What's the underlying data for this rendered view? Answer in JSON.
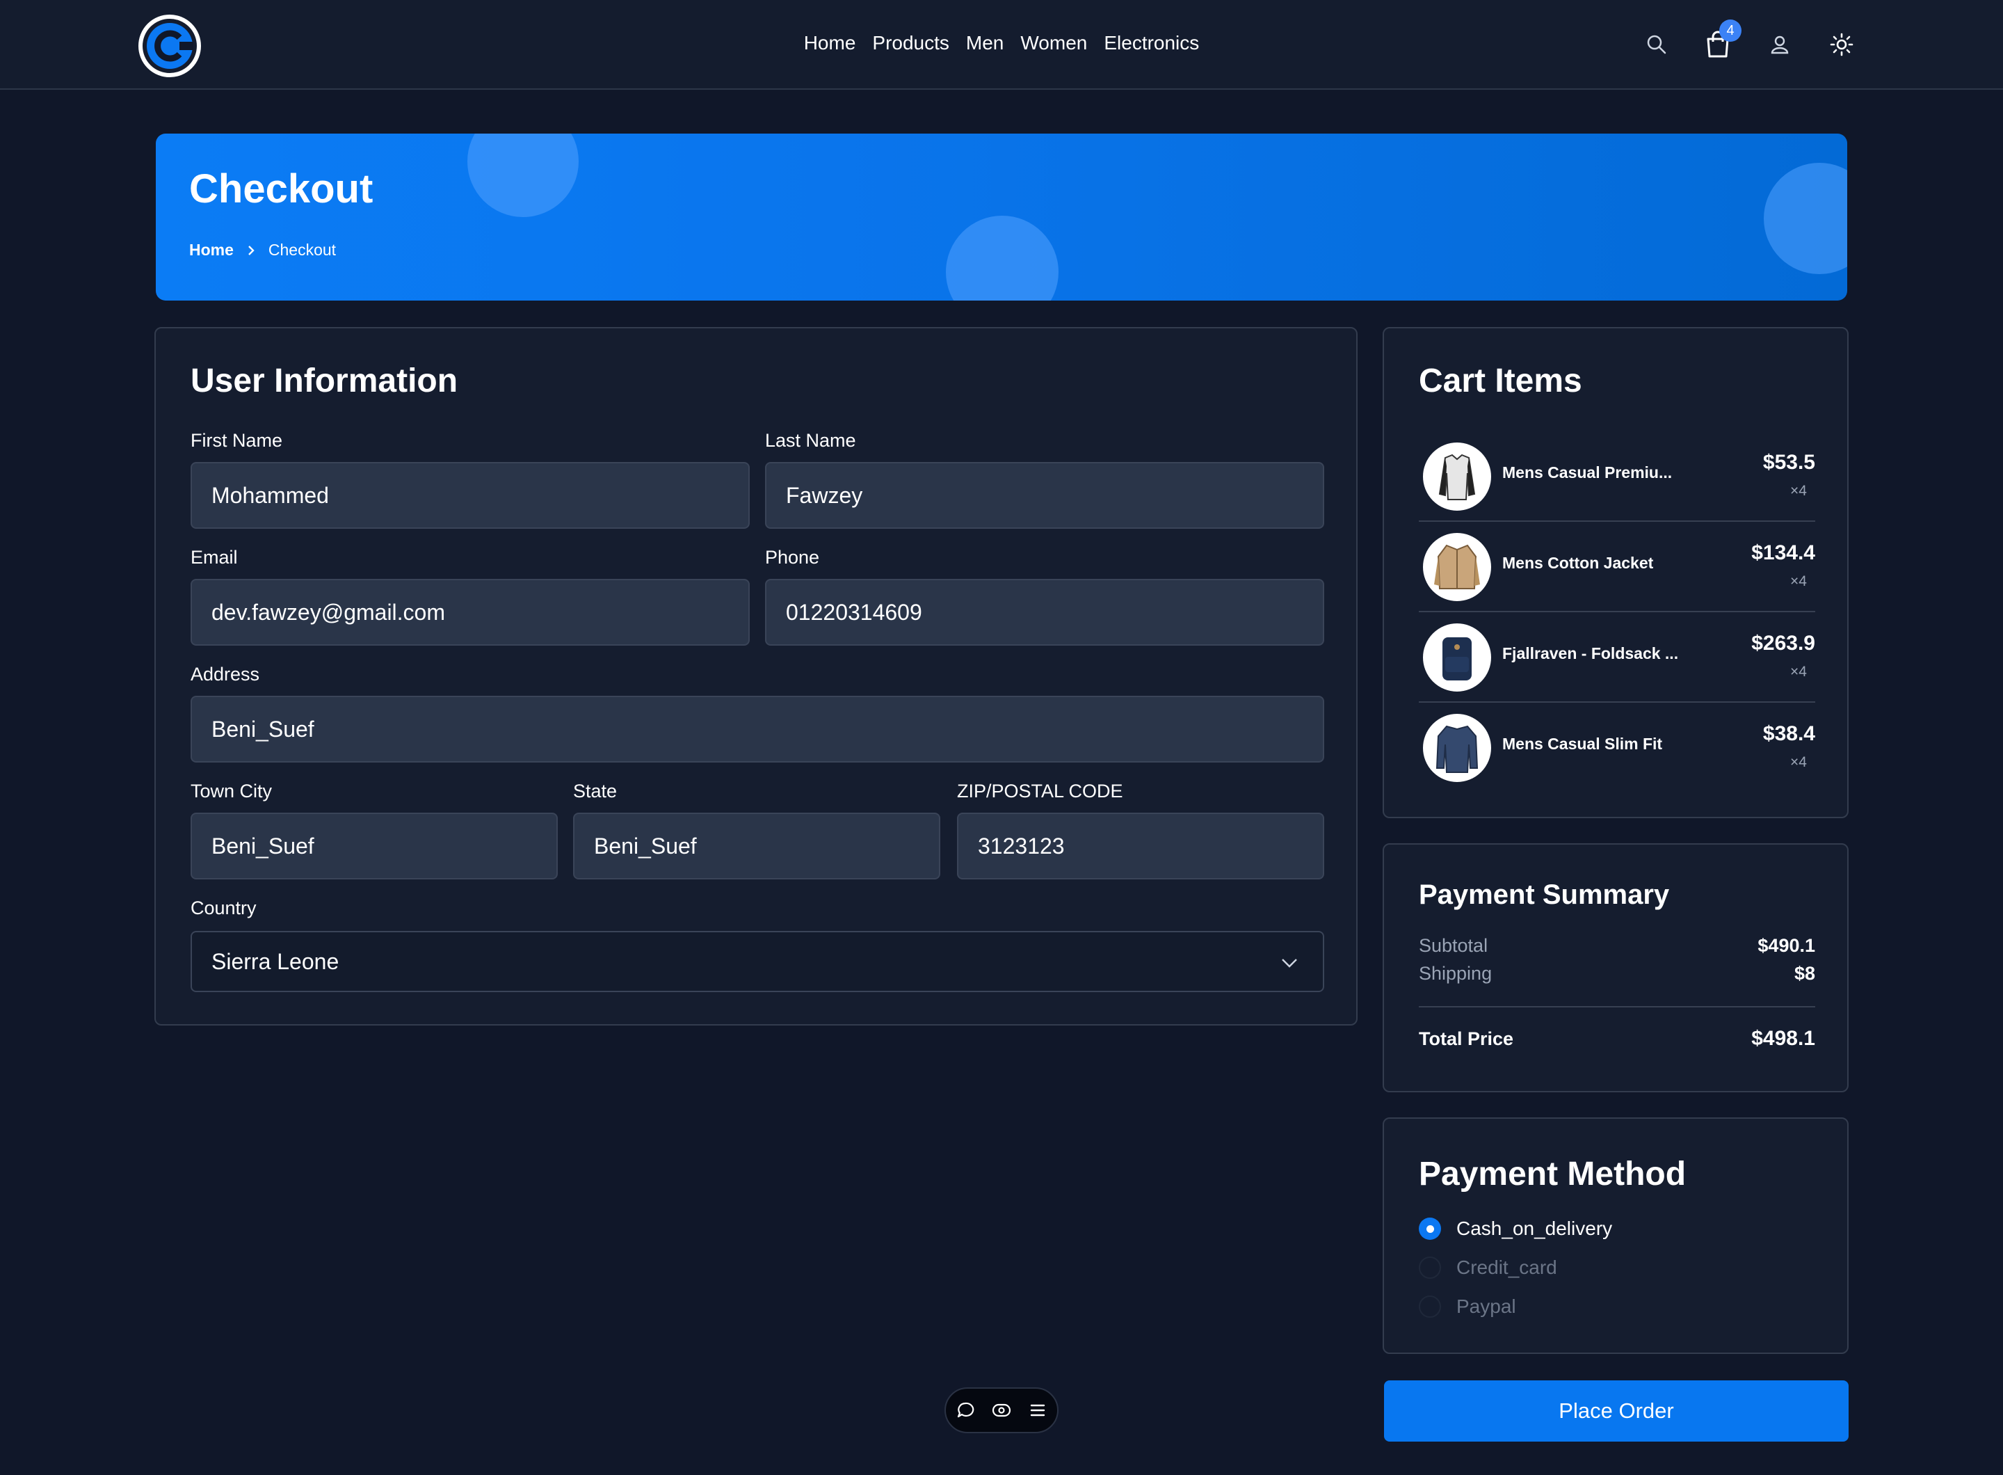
{
  "header": {
    "nav": [
      "Home",
      "Products",
      "Men",
      "Women",
      "Electronics"
    ],
    "cart_count": "4",
    "icons": [
      "search-icon",
      "cart-icon",
      "user-icon",
      "sun-icon"
    ]
  },
  "banner": {
    "title": "Checkout",
    "breadcrumb": {
      "home": "Home",
      "current": "Checkout"
    }
  },
  "user_info": {
    "title": "User Information",
    "first_name": {
      "label": "First Name",
      "value": "Mohammed"
    },
    "last_name": {
      "label": "Last Name",
      "value": "Fawzey"
    },
    "email": {
      "label": "Email",
      "value": "dev.fawzey@gmail.com"
    },
    "phone": {
      "label": "Phone",
      "value": "01220314609"
    },
    "address": {
      "label": "Address",
      "value": "Beni_Suef"
    },
    "town": {
      "label": "Town City",
      "value": "Beni_Suef"
    },
    "state": {
      "label": "State",
      "value": "Beni_Suef"
    },
    "zip": {
      "label": "ZIP/POSTAL CODE",
      "value": "3123123"
    },
    "country": {
      "label": "Country",
      "value": "Sierra Leone"
    }
  },
  "cart": {
    "title": "Cart Items",
    "items": [
      {
        "name": "Mens Casual Premiu...",
        "price": "$53.5",
        "qty": "×4"
      },
      {
        "name": "Mens Cotton Jacket",
        "price": "$134.4",
        "qty": "×4"
      },
      {
        "name": "Fjallraven - Foldsack ...",
        "price": "$263.9",
        "qty": "×4"
      },
      {
        "name": "Mens Casual Slim Fit",
        "price": "$38.4",
        "qty": "×4"
      }
    ]
  },
  "summary": {
    "title": "Payment Summary",
    "subtotal_label": "Subtotal",
    "subtotal": "$490.1",
    "shipping_label": "Shipping",
    "shipping": "$8",
    "total_label": "Total Price",
    "total": "$498.1"
  },
  "payment": {
    "title": "Payment Method",
    "options": [
      "Cash_on_delivery",
      "Credit_card",
      "Paypal"
    ],
    "selected": "Cash_on_delivery"
  },
  "place_order": "Place Order",
  "colors": {
    "accent": "#0877f0",
    "background": "#101729",
    "card": "#151d2f",
    "field": "#2a3549"
  }
}
